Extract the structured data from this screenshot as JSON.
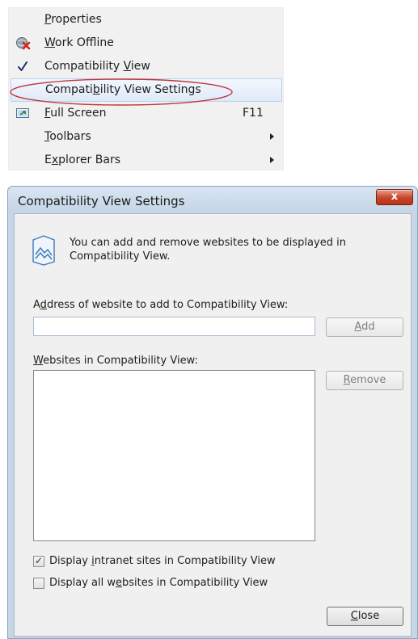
{
  "menu": {
    "items": [
      {
        "pre": "",
        "key": "P",
        "post": "roperties",
        "icon": "none"
      },
      {
        "pre": "",
        "key": "W",
        "post": "ork Offline",
        "icon": "work-offline-icon"
      },
      {
        "pre": "Compatibility ",
        "key": "V",
        "post": "iew",
        "icon": "checkmark-icon"
      },
      {
        "pre": "Compati",
        "key": "b",
        "post": "ility View Settings",
        "icon": "none"
      },
      {
        "pre": "",
        "key": "F",
        "post": "ull Screen",
        "icon": "full-screen-icon",
        "shortcut": "F11"
      },
      {
        "pre": "",
        "key": "T",
        "post": "oolbars",
        "icon": "none",
        "submenu": true
      },
      {
        "pre": "E",
        "key": "x",
        "post": "plorer Bars",
        "icon": "none",
        "submenu": true
      }
    ],
    "highlight_color": "#dfeaf8",
    "annotation_color": "#c0363a"
  },
  "dialog": {
    "title": "Compatibility View Settings",
    "close_glyph": "x",
    "info_line1": "You can add and remove websites to be displayed in",
    "info_line2": "Compatibility View.",
    "address_label": {
      "pre": "A",
      "key": "d",
      "post": "dress of website to add to Compatibility View:"
    },
    "address_value": "",
    "add_button": {
      "pre": "",
      "key": "A",
      "post": "dd"
    },
    "sites_label": {
      "pre": "",
      "key": "W",
      "post": "ebsites in Compatibility View:"
    },
    "sites": [],
    "remove_button": {
      "pre": "",
      "key": "R",
      "post": "emove"
    },
    "intranet_option": {
      "checked": true,
      "pre": "Display ",
      "key": "i",
      "post": "ntranet sites in Compatibility View"
    },
    "all_option": {
      "checked": false,
      "pre": "Display all w",
      "key": "e",
      "post": "bsites in Compatibility View"
    },
    "close_button": {
      "pre": "",
      "key": "C",
      "post": "lose"
    }
  }
}
